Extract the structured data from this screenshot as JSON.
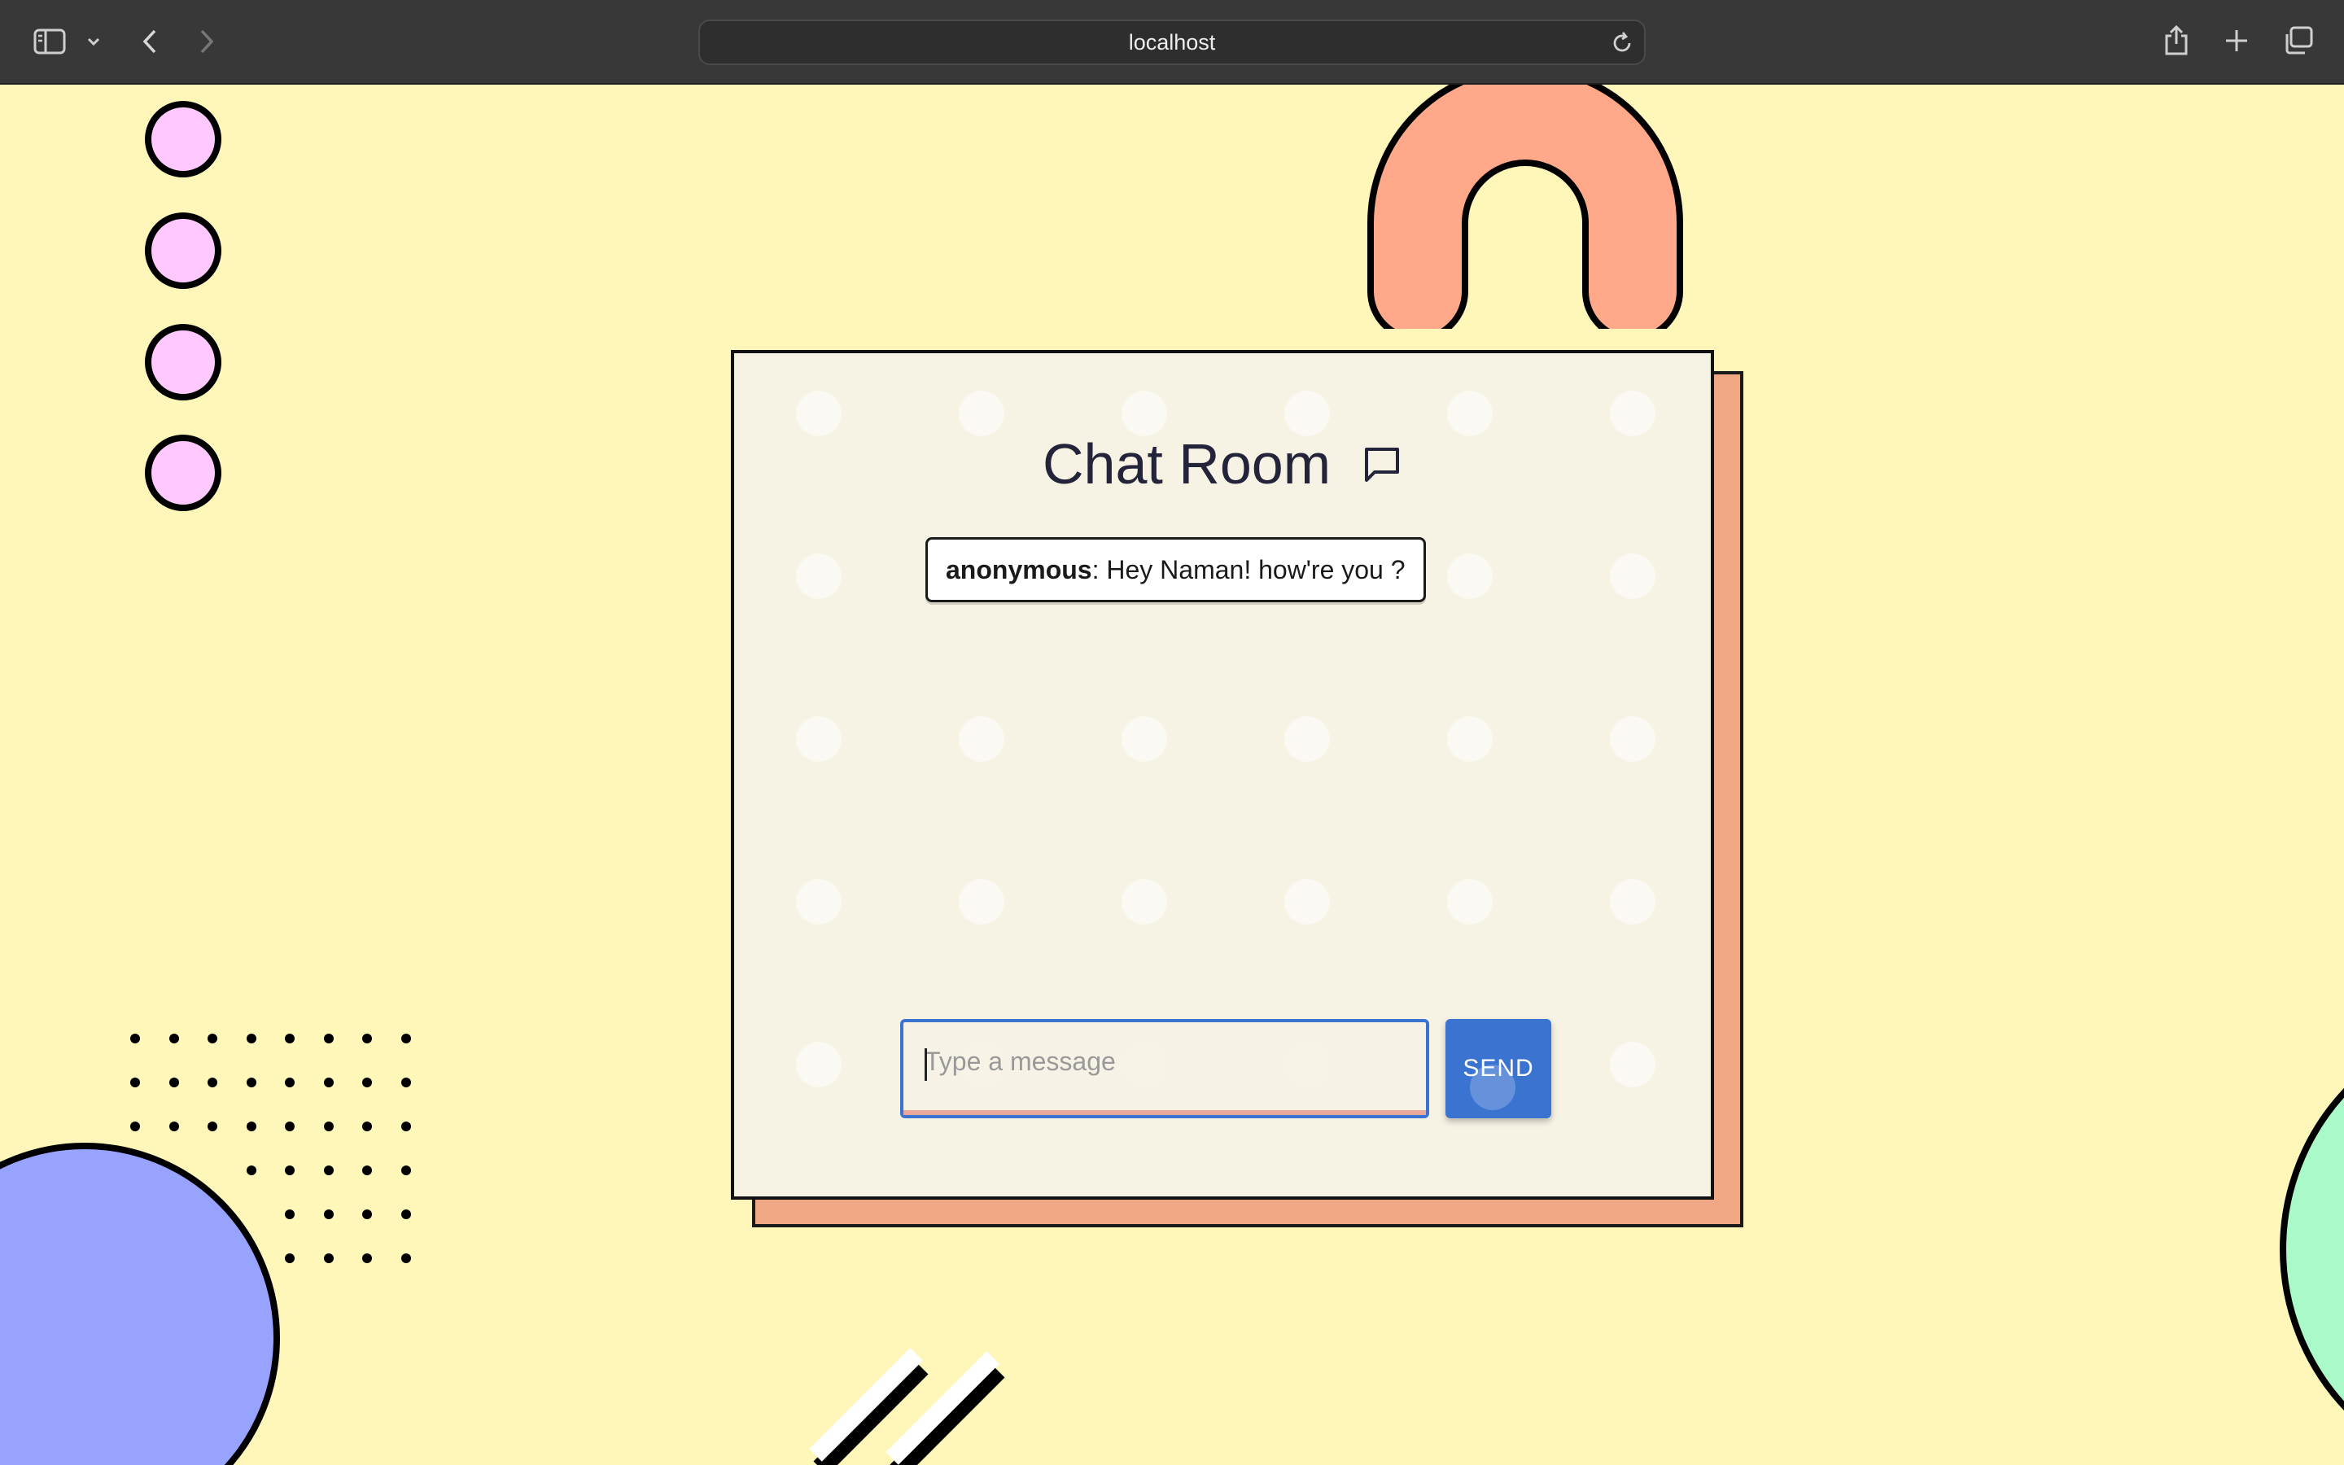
{
  "browser": {
    "url": "localhost",
    "icons": {
      "sidebar": "sidebar-icon",
      "sidebar_menu": "chevron-down-icon",
      "back": "back-arrow-icon",
      "forward": "forward-arrow-icon",
      "reload": "reload-icon",
      "share": "share-icon",
      "new_tab": "plus-icon",
      "tabs": "tab-overview-icon"
    }
  },
  "chat": {
    "title": "Chat Room",
    "title_icon": "chat-bubble-icon",
    "messages": [
      {
        "author": "anonymous",
        "separator": ": ",
        "text": "Hey Naman! how're you ?"
      }
    ],
    "input": {
      "placeholder": "Type a message",
      "value": ""
    },
    "send_label": "SEND"
  },
  "colors": {
    "background": "#fff7b9",
    "card": "#f6f2e4",
    "card_shadow": "#efa784",
    "accent": "#3a74d0",
    "pink_circles": "#ffc8ff",
    "orange_arch": "#ffa98a",
    "blue_circle": "#97a3fc",
    "green_ring": "#aaf9c8"
  }
}
